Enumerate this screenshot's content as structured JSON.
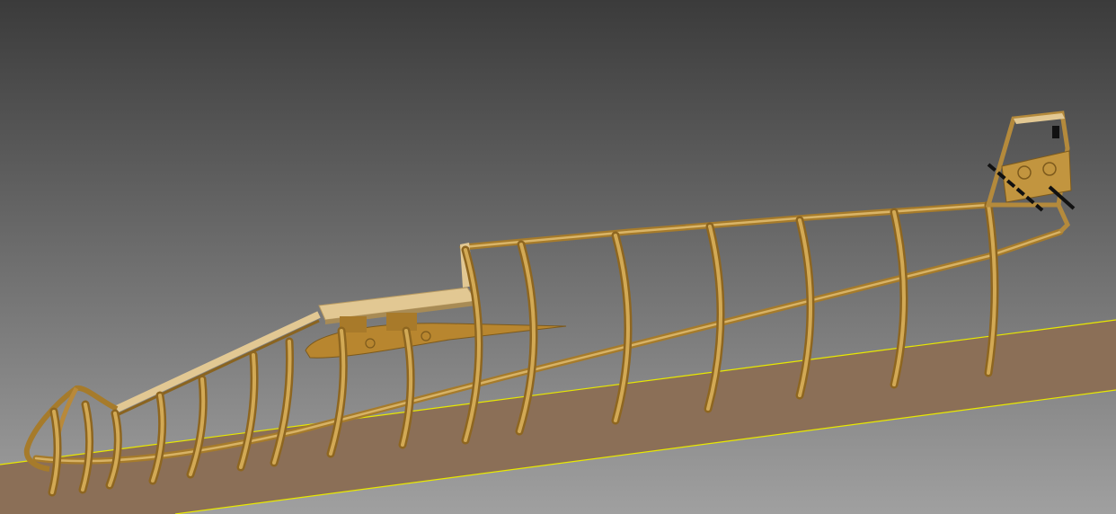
{
  "viewport": {
    "background_top": "#3a3a3a",
    "background_bottom": "#9a9a9a",
    "ground_plane_color": "#8b6f57",
    "ground_edge_color": "#e6e600",
    "wood_light": "#d4ad5e",
    "wood_dark": "#8a6420",
    "sheet_wood": "#e2c893",
    "dark_part": "#111111"
  },
  "model": {
    "parts": [
      "fuselage-frames",
      "top-stringers",
      "bottom-keel",
      "wing-root-rib",
      "forward-deck-sheet",
      "tail-post-assembly"
    ]
  }
}
